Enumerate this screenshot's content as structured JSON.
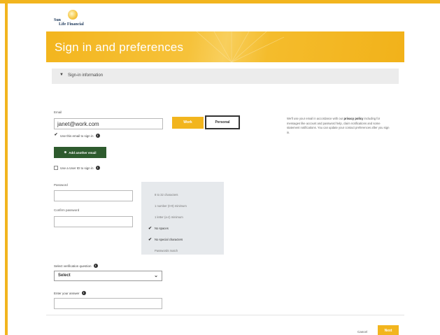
{
  "brand": {
    "line1": "Sun",
    "line2": "Life Financial"
  },
  "banner": {
    "title": "Sign in and preferences"
  },
  "section": {
    "title": "Sign-in information",
    "caret": "▼"
  },
  "email": {
    "label": "Email",
    "value": "janet@work.com",
    "type_options": [
      "Work",
      "Personal"
    ],
    "use_to_sign_in_label": "Use this email to sign in"
  },
  "add_email_label": "Add another email",
  "use_username_label": "Use a User ID to sign in",
  "side_text": {
    "part1": "We'll use your email in accordance with our",
    "link": "privacy policy",
    "part2": "including for messages like account and password help, claim notifications and some statement notifications. You can update your contact preferences after you sign in."
  },
  "password": {
    "label": "Password"
  },
  "confirm_password": {
    "label": "Confirm password"
  },
  "requirements": [
    {
      "text": "8 to 32 characters",
      "met": false
    },
    {
      "text": "1 number (0-9) minimum",
      "met": false
    },
    {
      "text": "1 letter (a-z) minimum",
      "met": false
    },
    {
      "text": "No spaces",
      "met": true
    },
    {
      "text": "No special characters",
      "met": true
    },
    {
      "text": "Passwords match",
      "met": false
    }
  ],
  "security_question": {
    "label": "Select verification question",
    "value": "Select",
    "arrow": "⌄"
  },
  "answer": {
    "label": "Enter your answer"
  },
  "footer": {
    "cancel": "Cancel",
    "next": "Next"
  },
  "colors": {
    "accent": "#f2b51e",
    "green": "#2e5b2e",
    "requirements_bg": "#e6e9ec"
  }
}
